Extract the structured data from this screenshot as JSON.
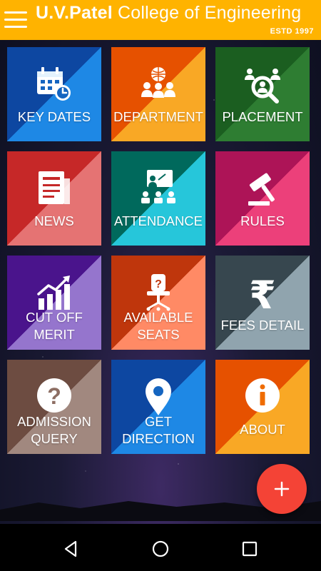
{
  "app_bar": {
    "title_bold": "U.V.Patel",
    "title_rest": " College of Engineering",
    "subtitle": "ESTD 1997",
    "color": "#ffb300"
  },
  "tiles": [
    {
      "line1": "KEY DATES",
      "line2": "",
      "icon": "calendar-clock-icon",
      "color_a": "#0d47a1",
      "color_b": "#1e88e5"
    },
    {
      "line1": "DEPARTMENT",
      "line2": "",
      "icon": "department-people-icon",
      "color_a": "#e65100",
      "color_b": "#f9a825"
    },
    {
      "line1": "PLACEMENT",
      "line2": "",
      "icon": "placement-search-icon",
      "color_a": "#1b5e20",
      "color_b": "#2e7d32"
    },
    {
      "line1": "NEWS",
      "line2": "",
      "icon": "newspaper-icon",
      "color_a": "#c62828",
      "color_b": "#e57373"
    },
    {
      "line1": "ATTENDANCE",
      "line2": "",
      "icon": "classroom-icon",
      "color_a": "#00695c",
      "color_b": "#26c6da"
    },
    {
      "line1": "RULES",
      "line2": "",
      "icon": "gavel-icon",
      "color_a": "#ad1457",
      "color_b": "#ec407a"
    },
    {
      "line1": "CUT OFF",
      "line2": "MERIT",
      "icon": "chart-up-icon",
      "color_a": "#4a148c",
      "color_b": "#9575cd"
    },
    {
      "line1": "AVAILABLE",
      "line2": "SEATS",
      "icon": "chair-icon",
      "color_a": "#bf360c",
      "color_b": "#ff8a65"
    },
    {
      "line1": "FEES DETAIL",
      "line2": "",
      "icon": "rupee-icon",
      "color_a": "#37474f",
      "color_b": "#90a4ae"
    },
    {
      "line1": "ADMISSION",
      "line2": "QUERY",
      "icon": "question-icon",
      "color_a": "#6d4c41",
      "color_b": "#a1887f"
    },
    {
      "line1": "GET",
      "line2": "DIRECTION",
      "icon": "location-pin-icon",
      "color_a": "#0d47a1",
      "color_b": "#1e88e5"
    },
    {
      "line1": "ABOUT",
      "line2": "",
      "icon": "info-icon",
      "color_a": "#e65100",
      "color_b": "#f9a825"
    }
  ],
  "fab": {
    "icon": "plus-icon",
    "color": "#f44336"
  },
  "nav": {
    "back": "back-icon",
    "home": "home-icon",
    "recents": "recents-icon"
  }
}
